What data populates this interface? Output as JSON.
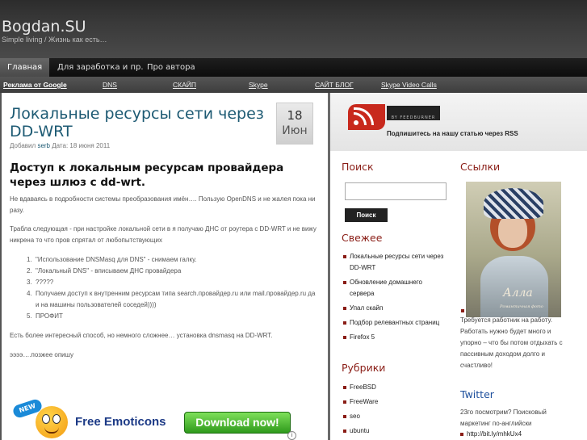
{
  "header": {
    "site_title": "Bogdan.SU",
    "site_description": "Simple living / Жизнь как есть…"
  },
  "nav": {
    "items": [
      {
        "label": "Главная",
        "active": true
      },
      {
        "label": "Для заработка и пр.",
        "active": false
      },
      {
        "label": "Про автора",
        "active": false
      }
    ]
  },
  "subnav": {
    "items": [
      {
        "label": "Реклама от Google",
        "bold": true
      },
      {
        "label": "DNS"
      },
      {
        "label": "СКАЙП"
      },
      {
        "label": "Skype"
      },
      {
        "label": "САЙТ БЛОГ"
      },
      {
        "label": "Skype Video Calls"
      }
    ]
  },
  "post": {
    "title": "Локальные ресурсы сети через DD-WRT",
    "meta_prefix": "Добавил",
    "meta_author": "serb",
    "meta_date": "Дата: 18 июня 2011",
    "date_day": "18",
    "date_month": "Июн",
    "heading": "Доступ к локальным ресурсам провайдера  через шлюз с dd-wrt.",
    "para1": "Не вдаваясь в подробности системы преобразования имён…. Пользую OpenDNS и не жалея пока ни разу.",
    "para2": "Трабла следующая - при настройке локальной сети в  я получаю ДНС от роутера с DD-WRT и не вижу никрена то что пров спрятал  от любопытствующих",
    "list": [
      {
        "num": "1.",
        "text": "\"Использование DNSMasq для DNS\" - снимаем галку."
      },
      {
        "num": "2.",
        "text": "\"Локальный DNS\"  - вписываем ДНС провайдера"
      },
      {
        "num": "3.",
        "text": "?????"
      },
      {
        "num": "4.",
        "text": "Получаем  доступ к внутренним ресурсам типа search.провайдер.ru или mail.провайдер.ru да и на машины пользователей соседей))))"
      },
      {
        "num": "5.",
        "text": "ПРОФИТ"
      }
    ],
    "para3": "Есть более интересный способ, но немного сложнее… установка dnsmasq на DD-WRT.",
    "para4": "ээээ….позжее опишу"
  },
  "ad": {
    "new_badge": "NEW",
    "text": "Free Emoticons",
    "button_label": "Download now!",
    "info": "i"
  },
  "sidebar": {
    "feedburner_label": "BY FEEDBURNER",
    "rss_label": "Подпишитесь на нашу статью через RSS",
    "search_title": "Поиск",
    "search_button": "Поиск",
    "recent_title": "Свежее",
    "recent_items": [
      "Локальные ресурсы сети через DD-WRT",
      "Обновление домашнего сервера",
      "Упал скайп",
      "Подбор релевантных страниц",
      "Firefox 5"
    ],
    "categories_title": "Рубрики",
    "categories_items": [
      "FreeBSD",
      "FreeWare",
      "seo",
      "ubuntu"
    ],
    "links_title": "Ссылки",
    "photo_signature": "Алла",
    "photo_caption": "Романтичная фото",
    "links_text": "Требуется работник на работу. Работать нужно будет много и упорно – что бы потом отдыхать с пассивным доходом долго и счастливо!",
    "twitter_title": "Twitter",
    "twitter_text": "23го посмотрим? Поисковый маркетинг по-английски",
    "twitter_link": "http://bit.ly/mhkUx4"
  },
  "colors": {
    "title_blue": "#1d5a73",
    "widget_red": "#8a1d16",
    "twitter_blue": "#1d4f9c"
  }
}
